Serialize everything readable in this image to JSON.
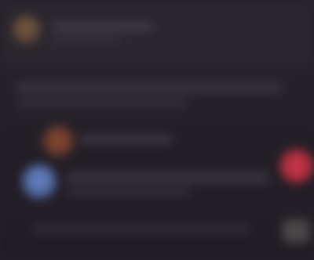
{
  "screen": {
    "description_visible_text": "",
    "colors": {
      "background": "#262129",
      "avatar_top": "#6b5140",
      "avatar_mid": "#7a432d",
      "avatar_blue": "#5a74b5",
      "badge_red": "#c43444",
      "icon_gray": "#4a4647"
    }
  },
  "header": {
    "title": "",
    "subtitle": ""
  },
  "message": {
    "line1": "",
    "line2": ""
  },
  "item_mid": {
    "label": ""
  },
  "item_blue": {
    "title": "",
    "subtitle": ""
  },
  "footer": {
    "text": ""
  }
}
